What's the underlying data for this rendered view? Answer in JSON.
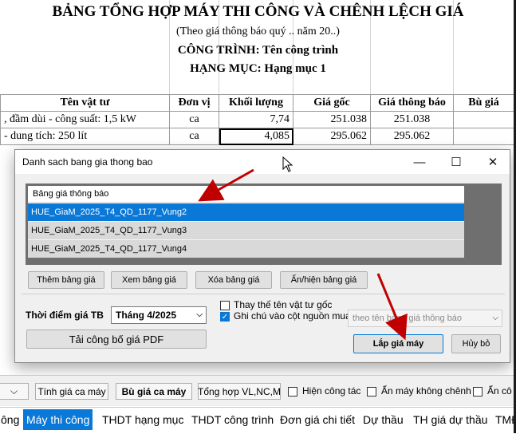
{
  "sheet": {
    "title": "BẢNG TỔNG HỢP MÁY THI CÔNG VÀ CHÊNH LỆCH GIÁ",
    "subtitle": "(Theo giá thông báo quý .. năm 20..)",
    "project": "CÔNG TRÌNH: Tên công trình",
    "item": "HẠNG MỤC: Hạng mục 1",
    "columns": [
      "Tên vật tư",
      "Đơn vị",
      "Khối lượng",
      "Giá gốc",
      "Giá thông báo",
      "Bù giá"
    ],
    "rows": [
      {
        "name": ", đầm dùi - công suất: 1,5 kW",
        "unit": "ca",
        "qty": "7,74",
        "base": "251.038",
        "notice": "251.038",
        "diff": ""
      },
      {
        "name": " - dung tích: 250 lít",
        "unit": "ca",
        "qty": "4,085",
        "base": "295.062",
        "notice": "295.062",
        "diff": ""
      }
    ]
  },
  "dialog": {
    "title": "Danh sach bang gia thong bao",
    "window_controls": {
      "minimize": "—",
      "maximize": "☐",
      "close": "✕"
    },
    "list_header": "Bảng giá thông báo",
    "list_items": [
      "HUE_GiaM_2025_T4_QD_1177_Vung2",
      "HUE_GiaM_2025_T4_QD_1177_Vung3",
      "HUE_GiaM_2025_T4_QD_1177_Vung4"
    ],
    "buttons": {
      "add": "Thêm bảng giá",
      "view": "Xem bảng giá",
      "delete": "Xóa bảng giá",
      "toggle": "Ẩn/hiện bảng giá",
      "download_pdf": "Tải công bố giá PDF",
      "apply": "Lắp giá máy",
      "cancel": "Hủy bỏ"
    },
    "period_label": "Thời điểm giá TB",
    "period_value": "Tháng 4/2025",
    "replace_name_label": "Thay thế tên vật tư gốc",
    "note_source_label": "Ghi chú vào cột nguồn mua",
    "note_source_checked": true,
    "replace_name_checked": false,
    "source_select": "theo tên bảng giá thông báo"
  },
  "toolbar": {
    "calc_button": "Tính giá ca máy",
    "bu_button": "Bù giá ca máy",
    "summary_button": "Tổng hợp VL,NC,M",
    "show_work_label": "Hiện công tác",
    "hide_machine_label": "Ẩn máy không chênh",
    "hide_more_label": "Ẩn cô"
  },
  "tabs": [
    "ông",
    "Máy thi công",
    "THDT hạng mục",
    "THDT công trình",
    "Đơn giá chi tiết",
    "Dự thầu",
    "TH giá dự thầu",
    "TMĐ"
  ],
  "active_tab": "Máy thi công",
  "colors": {
    "accent": "#0a78d7",
    "arrow": "#c00000"
  }
}
